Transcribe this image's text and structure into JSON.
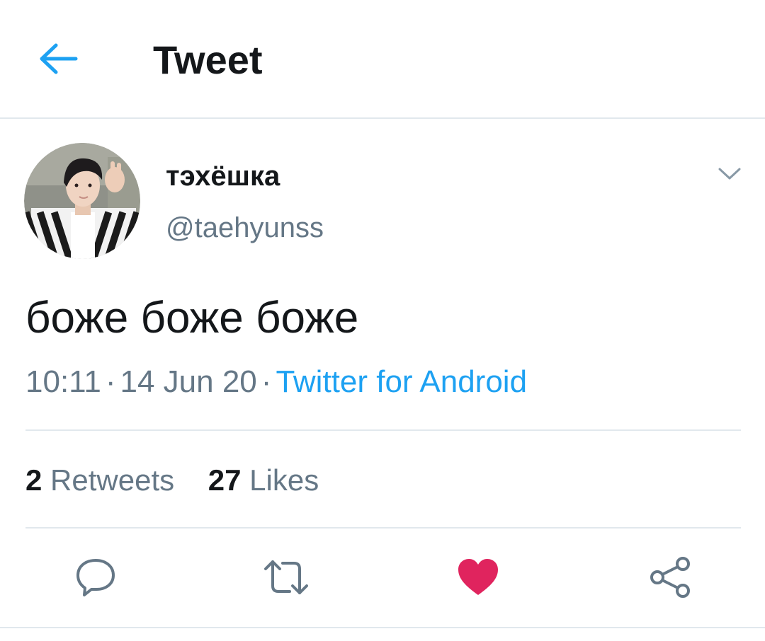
{
  "header": {
    "title": "Tweet",
    "back_icon": "arrow-left-icon"
  },
  "author": {
    "display_name": "тэхёшка",
    "handle": "@taehyunss",
    "avatar": "profile-photo"
  },
  "tweet": {
    "text": "боже боже боже",
    "time": "10:11",
    "date": "14 Jun 20",
    "separator": "·",
    "source": "Twitter for Android"
  },
  "stats": {
    "retweets_count": "2",
    "retweets_label": "Retweets",
    "likes_count": "27",
    "likes_label": "Likes"
  },
  "actions": [
    {
      "name": "reply",
      "icon": "speech-bubble-icon"
    },
    {
      "name": "retweet",
      "icon": "retweet-icon"
    },
    {
      "name": "like",
      "icon": "heart-icon",
      "liked": true
    },
    {
      "name": "share",
      "icon": "share-icon"
    }
  ],
  "colors": {
    "accent": "#1da1f2",
    "like": "#e0245e",
    "secondary_text": "#657786",
    "primary_text": "#14171a",
    "divider": "#e1e8ed"
  }
}
